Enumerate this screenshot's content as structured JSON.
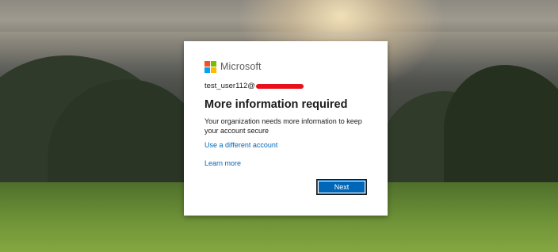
{
  "brand": {
    "name": "Microsoft",
    "logo_colors": [
      "#f25022",
      "#7fba00",
      "#00a4ef",
      "#ffb900"
    ]
  },
  "account": {
    "email_visible": "test_user112@",
    "redaction_color": "#e8101a"
  },
  "dialog": {
    "title": "More information required",
    "description": "Your organization needs more information to keep your account secure",
    "use_different_account_link": "Use a different account",
    "learn_more_link": "Learn more",
    "next_button_label": "Next"
  },
  "colors": {
    "link": "#0067b8",
    "primary_button": "#0067b8",
    "dialog_background": "#ffffff"
  }
}
